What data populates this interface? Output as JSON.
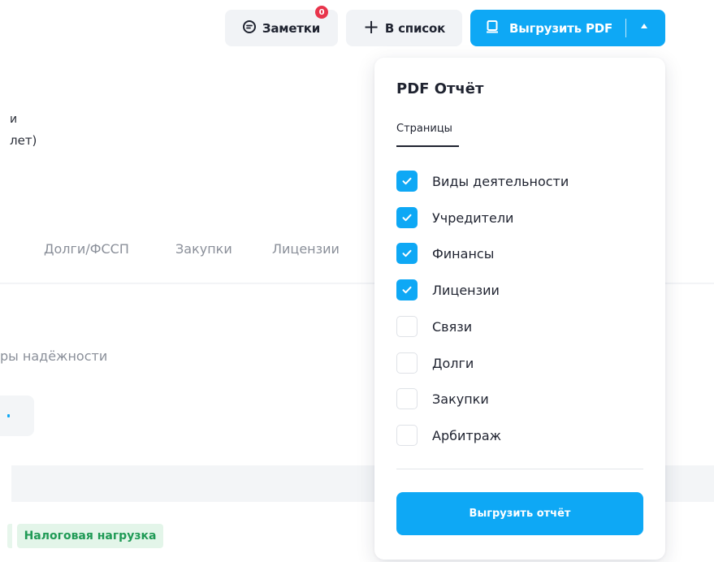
{
  "toolbar": {
    "notes_label": "Заметки",
    "notes_count": "0",
    "add_to_list_label": "В список",
    "export_pdf_label": "Выгрузить PDF"
  },
  "background": {
    "line1": "и",
    "line2": "лет)",
    "tabs": [
      "Долги/ФССП",
      "Закупки",
      "Лицензии"
    ],
    "reliability_text": "ры надёжности",
    "tag_label": "Налоговая нагрузка"
  },
  "pdf_panel": {
    "title": "PDF Отчёт",
    "tab_label": "Страницы",
    "options": [
      {
        "label": "Виды деятельности",
        "checked": true
      },
      {
        "label": "Учредители",
        "checked": true
      },
      {
        "label": "Финансы",
        "checked": true
      },
      {
        "label": "Лицензии",
        "checked": true
      },
      {
        "label": "Связи",
        "checked": false
      },
      {
        "label": "Долги",
        "checked": false
      },
      {
        "label": "Закупки",
        "checked": false
      },
      {
        "label": "Арбитраж",
        "checked": false
      }
    ],
    "export_button_label": "Выгрузить отчёт"
  },
  "colors": {
    "accent": "#0ea8f5",
    "badge": "#e8344b",
    "tag_bg": "#e3f5e9",
    "tag_text": "#1f9a55"
  }
}
